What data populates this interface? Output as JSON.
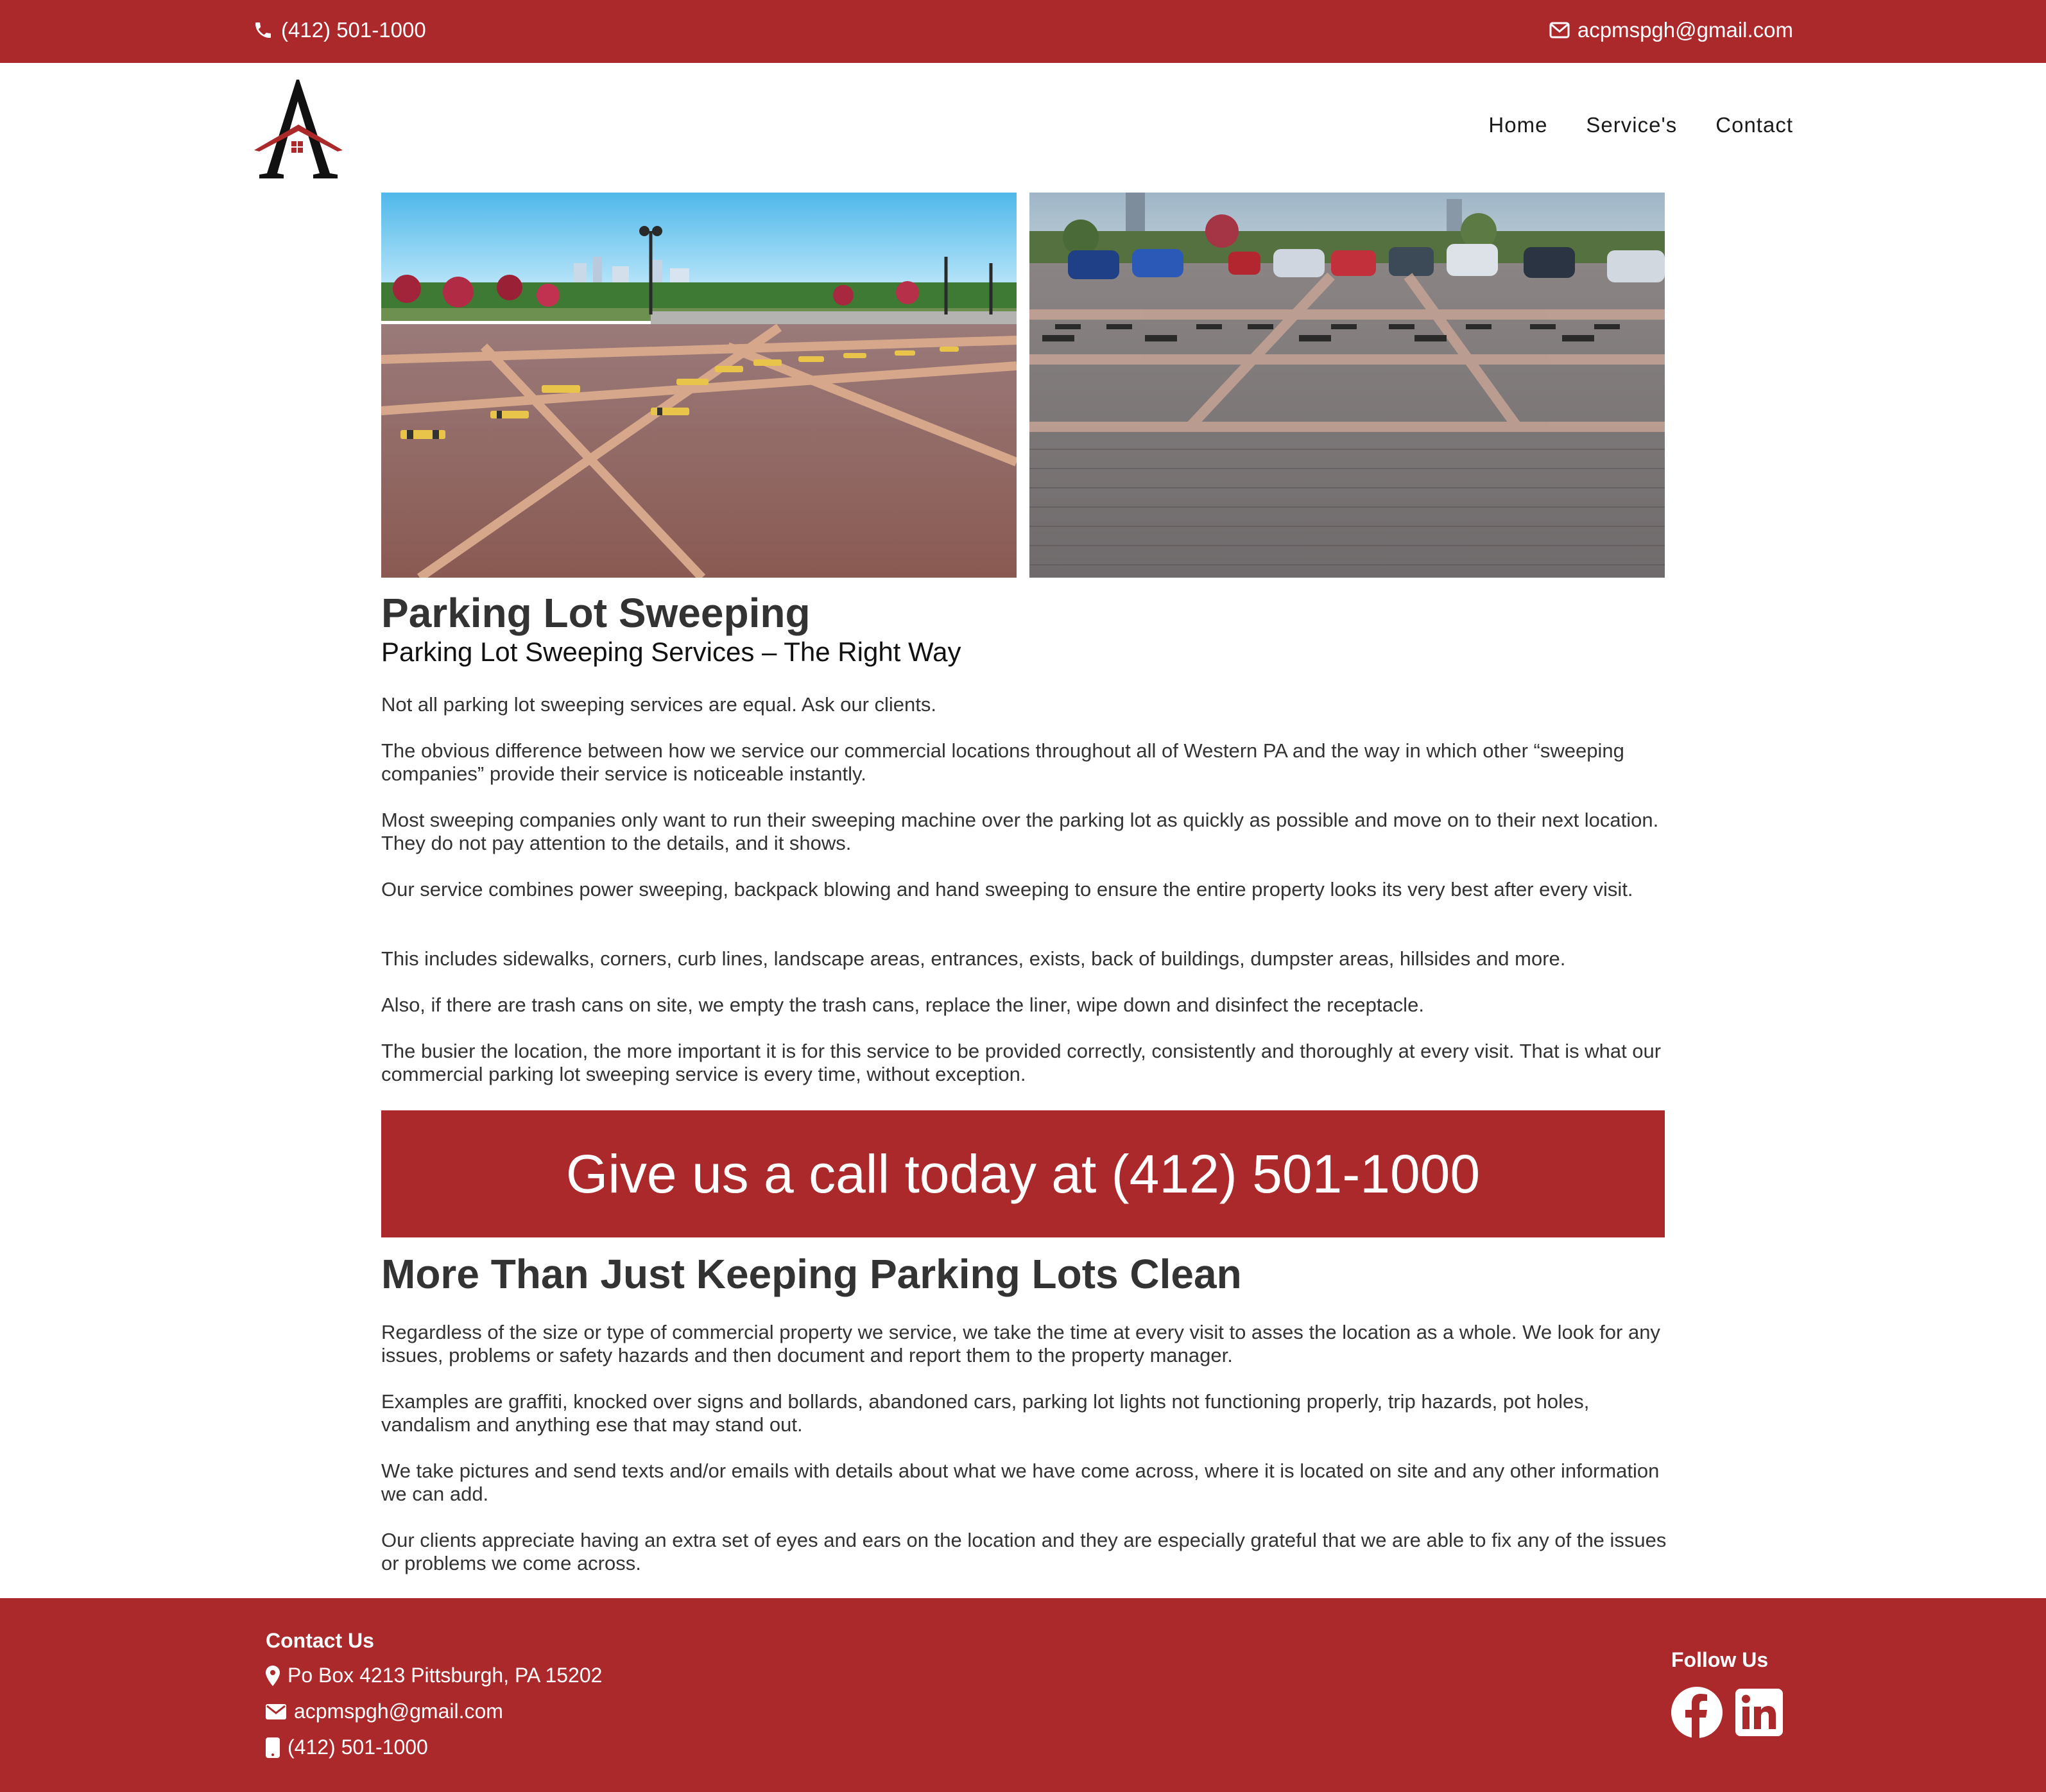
{
  "topbar": {
    "phone": "(412) 501-1000",
    "email": "acpmspgh@gmail.com"
  },
  "nav": {
    "items": [
      "Home",
      "Service's",
      "Contact"
    ]
  },
  "section1": {
    "title": "Parking Lot Sweeping",
    "subtitle": "Parking Lot Sweeping Services – The Right Way",
    "paragraphs": [
      "Not all parking lot sweeping services are equal. Ask our clients.",
      "The obvious difference between how we service our commercial locations throughout all of Western PA and the way in which other “sweeping companies” provide their service is noticeable instantly.",
      "Most sweeping companies only want to run their sweeping machine over the parking lot as quickly as possible and move on to their next location. They do not pay attention to the details, and it shows.",
      "Our service combines power sweeping, backpack blowing and hand sweeping to ensure the entire property looks its very best after every visit.",
      "This includes sidewalks, corners, curb lines, landscape areas, entrances, exists, back of buildings, dumpster areas, hillsides and more.",
      "Also, if there are trash cans on site, we empty the trash cans, replace the liner, wipe down and disinfect the receptacle.",
      "The busier the location, the more important it is for this service to be provided correctly, consistently and thoroughly at every visit. That is what our commercial parking lot sweeping service is every time, without exception."
    ]
  },
  "cta": {
    "text": "Give us a call today at (412) 501-1000"
  },
  "section2": {
    "title": "More Than Just Keeping Parking Lots Clean",
    "paragraphs": [
      "Regardless of the size or type of commercial property we service, we take the time at every visit to asses the location as a whole. We look for any issues, problems or safety hazards and then document and report them to the property manager.",
      "Examples are graffiti, knocked over signs and bollards, abandoned cars, parking lot lights not functioning properly, trip hazards, pot holes, vandalism and anything ese that may stand out.",
      "We take pictures and send texts and/or emails with details about what we have come across, where it is located on site and any other information we can add.",
      "Our clients appreciate having an extra set of eyes and ears on the location and they are especially grateful that we are able to fix any of the issues or problems we come across."
    ]
  },
  "footer": {
    "contact_title": "Contact Us",
    "address": "Po Box 4213 Pittsburgh, PA 15202",
    "email": "acpmspgh@gmail.com",
    "phone": "(412) 501-1000",
    "follow_title": "Follow Us"
  },
  "icons": {
    "phone": "phone-icon",
    "email": "envelope-icon",
    "location": "map-marker-icon",
    "mobile": "mobile-icon",
    "facebook": "facebook-icon",
    "linkedin": "linkedin-icon"
  },
  "colors": {
    "brand": "#ab282b",
    "text": "#333333",
    "background": "#ffffff"
  }
}
